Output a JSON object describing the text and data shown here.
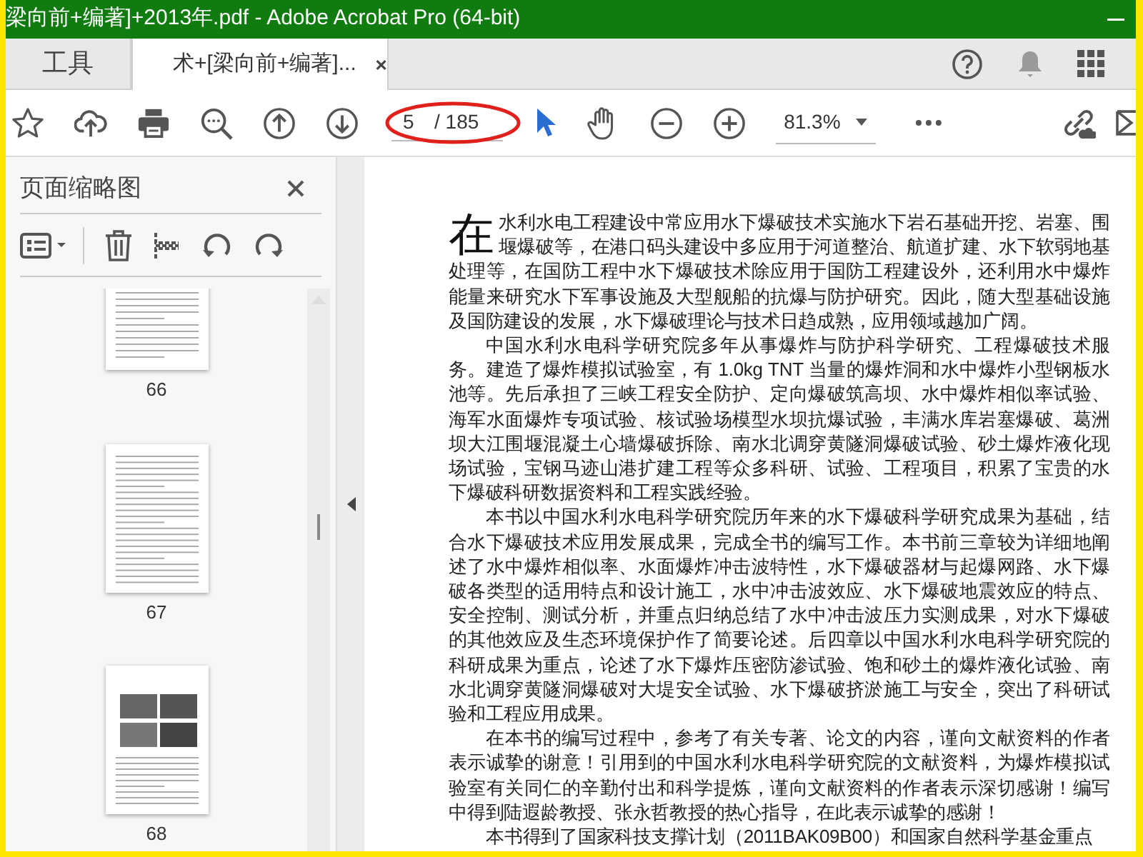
{
  "window": {
    "title": "梁向前+编著]+2013年.pdf - Adobe Acrobat Pro (64-bit)"
  },
  "tabs": [
    {
      "label": "工具",
      "selected": false
    },
    {
      "label": "术+[梁向前+编著]...",
      "selected": true
    }
  ],
  "toolbar": {
    "page_current": "5",
    "page_total": "/ 185",
    "zoom": "81.3%"
  },
  "sidebar": {
    "title": "页面缩略图",
    "thumbnails": [
      {
        "label": "66",
        "kind": "text"
      },
      {
        "label": "67",
        "kind": "text"
      },
      {
        "label": "68",
        "kind": "photos"
      }
    ]
  },
  "document": {
    "drop_cap": true,
    "paragraphs": [
      "在水利水电工程建设中常应用水下爆破技术实施水下岩石基础开挖、岩塞、围堰爆破等，在港口码头建设中多应用于河道整治、航道扩建、水下软弱地基处理等，在国防工程中水下爆破技术除应用于国防工程建设外，还利用水中爆炸能量来研究水下军事设施及大型舰船的抗爆与防护研究。因此，随大型基础设施及国防建设的发展，水下爆破理论与技术日趋成熟，应用领域越加广阔。",
      "中国水利水电科学研究院多年从事爆炸与防护科学研究、工程爆破技术服务。建造了爆炸模拟试验室，有 1.0kg TNT 当量的爆炸洞和水中爆炸小型钢板水池等。先后承担了三峡工程安全防护、定向爆破筑高坝、水中爆炸相似率试验、海军水面爆炸专项试验、核试验场模型水坝抗爆试验，丰满水库岩塞爆破、葛洲坝大江围堰混凝土心墙爆破拆除、南水北调穿黄隧洞爆破试验、砂土爆炸液化现场试验，宝钢马迹山港扩建工程等众多科研、试验、工程项目，积累了宝贵的水下爆破科研数据资料和工程实践经验。",
      "本书以中国水利水电科学研究院历年来的水下爆破科学研究成果为基础，结合水下爆破技术应用发展成果，完成全书的编写工作。本书前三章较为详细地阐述了水中爆炸相似率、水面爆炸冲击波特性，水下爆破器材与起爆网路、水下爆破各类型的适用特点和设计施工，水中冲击波效应、水下爆破地震效应的特点、安全控制、测试分析，并重点归纳总结了水中冲击波压力实测成果，对水下爆破的其他效应及生态环境保护作了简要论述。后四章以中国水利水电科学研究院的科研成果为重点，论述了水下爆炸压密防渗试验、饱和砂土的爆炸液化试验、南水北调穿黄隧洞爆破对大堤安全试验、水下爆破挤淤施工与安全，突出了科研试验和工程应用成果。",
      "在本书的编写过程中，参考了有关专著、论文的内容，谨向文献资料的作者表示诚挚的谢意！引用到的中国水利水电科学研究院的文献资料，为爆炸模拟试验室有关同仁的辛勤付出和科学提炼，谨向文献资料的作者表示深切感谢！编写中得到陆遐龄教授、张永哲教授的热心指导，在此表示诚挚的感谢！",
      "本书得到了国家科技支撑计划（2011BAK09B00）和国家自然科学基金重点"
    ]
  }
}
